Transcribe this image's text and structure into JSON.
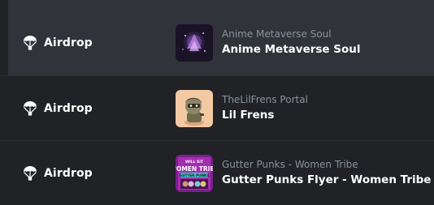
{
  "rows": [
    {
      "event_label": "Airdrop",
      "event_icon": "parachute-icon",
      "collection": "Anime Metaverse Soul",
      "item_name": "Anime Metaverse Soul",
      "highlighted": true
    },
    {
      "event_label": "Airdrop",
      "event_icon": "parachute-icon",
      "collection": "TheLilFrens Portal",
      "item_name": "Lil Frens",
      "highlighted": false
    },
    {
      "event_label": "Airdrop",
      "event_icon": "parachute-icon",
      "collection": "Gutter Punks - Women Tribe",
      "item_name": "Gutter Punks Flyer - Women Tribe",
      "highlighted": false
    }
  ],
  "thumbnails": {
    "row3_text_top": "WILL SIT",
    "row3_text_main": "WOMEN TRIBE",
    "row3_text_sub": "GUTTER PUNKS"
  },
  "colors": {
    "background": "#202225",
    "highlight": "#303339",
    "primary_text": "#ffffff",
    "secondary_text": "#8a939b"
  }
}
